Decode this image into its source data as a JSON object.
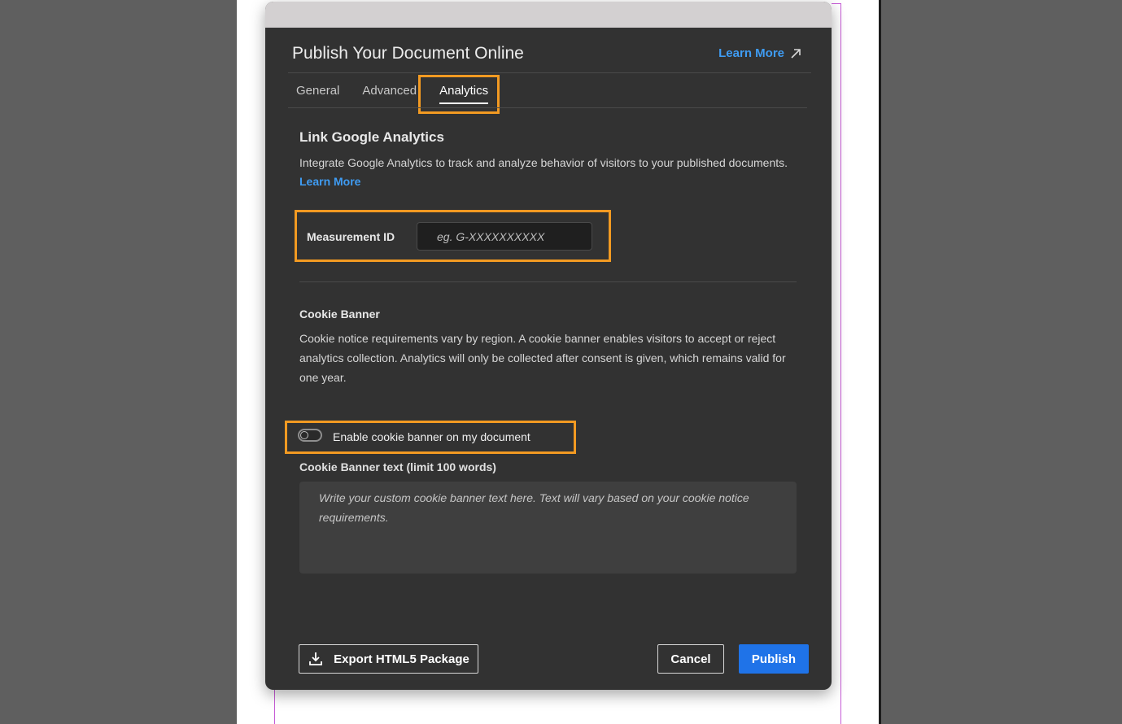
{
  "dialog": {
    "title": "Publish Your Document Online",
    "learn_more_top": "Learn More",
    "tabs": [
      {
        "label": "General",
        "active": false
      },
      {
        "label": "Advanced",
        "active": false
      },
      {
        "label": "Analytics",
        "active": true
      }
    ]
  },
  "analytics": {
    "title": "Link Google Analytics",
    "description": "Integrate Google Analytics to track and analyze behavior of visitors to your published documents.",
    "learn_more": "Learn More",
    "measurement_label": "Measurement ID",
    "measurement_value": "",
    "measurement_placeholder": "eg. G-XXXXXXXXXX"
  },
  "cookie": {
    "title": "Cookie Banner",
    "description_lines": [
      "Cookie notice requirements vary by region. A cookie banner enables visitors to accept or reject",
      "analytics collection. Analytics will only be collected after consent is given, which remains valid for",
      "one year."
    ],
    "toggle_label": "Enable cookie banner on my document",
    "toggle_on": false,
    "text_label": "Cookie Banner text (limit 100 words)",
    "text_value": "",
    "text_placeholder": "Write your custom cookie banner text here. Text will vary based on your cookie notice requirements."
  },
  "footer": {
    "export_label": "Export HTML5 Package",
    "cancel_label": "Cancel",
    "publish_label": "Publish"
  },
  "colors": {
    "highlight": "#f29a22",
    "link": "#3f9cf3",
    "primary": "#1f73e8",
    "dialog_bg": "#323232"
  },
  "icons": [
    "arrow-up-right-icon",
    "download-icon"
  ]
}
